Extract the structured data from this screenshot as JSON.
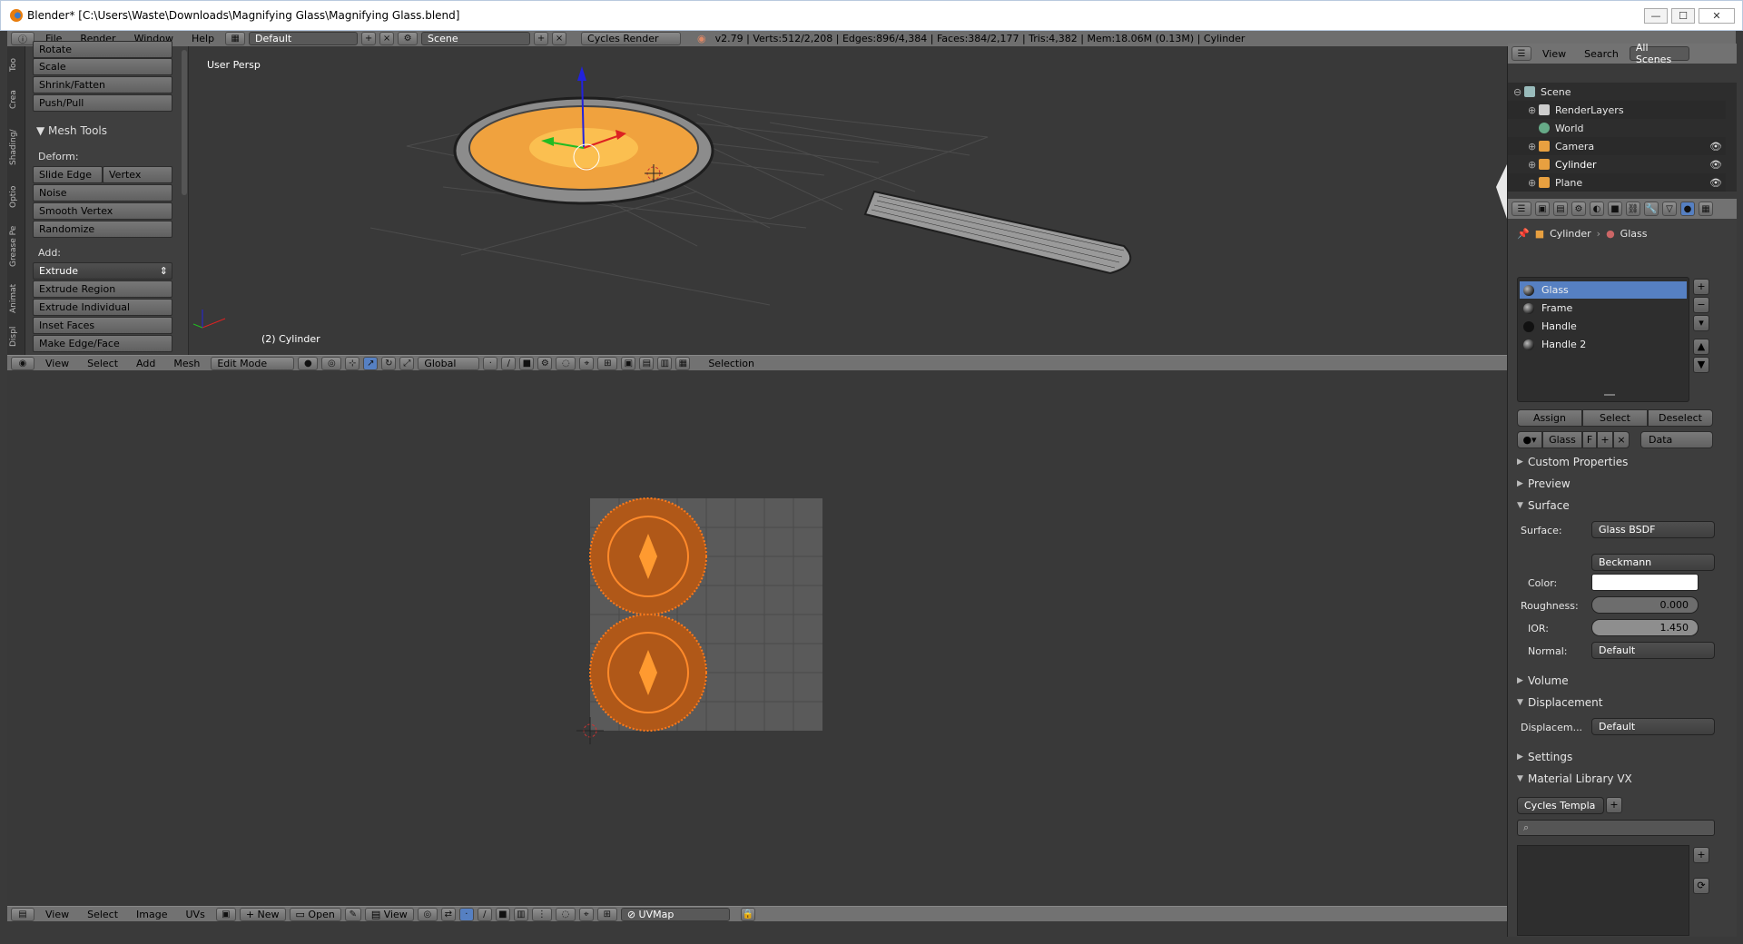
{
  "window": {
    "title": "Blender* [C:\\Users\\Waste\\Downloads\\Magnifying Glass\\Magnifying Glass.blend]",
    "minimize": "—",
    "maximize": "☐",
    "close": "✕"
  },
  "topbar": {
    "menus": [
      "File",
      "Render",
      "Window",
      "Help"
    ],
    "layout": "Default",
    "scene": "Scene",
    "engine": "Cycles Render",
    "stats": "v2.79 | Verts:512/2,208 | Edges:896/4,384 | Faces:384/2,177 | Tris:4,382 | Mem:18.06M (0.13M) | Cylinder"
  },
  "tools": {
    "tabs": [
      "Too",
      "Crea",
      "Shading/",
      "Optio",
      "Grease Pe",
      "Animat",
      "Displ"
    ],
    "transform_buttons": [
      "Rotate",
      "Scale",
      "Shrink/Fatten",
      "Push/Pull"
    ],
    "mesh_tools_title": "Mesh Tools",
    "deform_label": "Deform:",
    "slide_edge": "Slide Edge",
    "vertex": "Vertex",
    "deform_buttons": [
      "Noise",
      "Smooth Vertex",
      "Randomize"
    ],
    "add_label": "Add:",
    "extrude": "Extrude",
    "add_buttons": [
      "Extrude Region",
      "Extrude Individual",
      "Inset Faces",
      "Make Edge/Face"
    ]
  },
  "viewport3d": {
    "view_label": "User Persp",
    "object_label": "(2) Cylinder"
  },
  "view3d_header": {
    "menus": [
      "View",
      "Select",
      "Add",
      "Mesh"
    ],
    "mode": "Edit Mode",
    "orientation": "Global",
    "selection": "Selection"
  },
  "uv_header": {
    "menus": [
      "View",
      "Select",
      "Image",
      "UVs"
    ],
    "new": "New",
    "open": "Open",
    "view": "View",
    "uvmap": "UVMap"
  },
  "outliner": {
    "view": "View",
    "search": "Search",
    "scope": "All Scenes",
    "items": [
      "Scene",
      "RenderLayers",
      "World",
      "Camera",
      "Cylinder",
      "Plane"
    ]
  },
  "properties": {
    "breadcrumb_object": "Cylinder",
    "breadcrumb_material": "Glass",
    "materials": [
      "Glass",
      "Frame",
      "Handle",
      "Handle 2"
    ],
    "assign": "Assign",
    "select": "Select",
    "deselect": "Deselect",
    "mat_name": "Glass",
    "fake": "F",
    "link": "Data",
    "panels": {
      "custom": "Custom Properties",
      "preview": "Preview",
      "surface": "Surface",
      "volume": "Volume",
      "displacement": "Displacement",
      "settings": "Settings",
      "matlib": "Material Library VX"
    },
    "surface_label": "Surface:",
    "surface_value": "Glass BSDF",
    "distribution": "Beckmann",
    "color_label": "Color:",
    "color_value": "#ffffff",
    "roughness_label": "Roughness:",
    "roughness_value": "0.000",
    "ior_label": "IOR:",
    "ior_value": "1.450",
    "normal_label": "Normal:",
    "normal_value": "Default",
    "displacement_label": "Displacem...",
    "displacement_value": "Default",
    "template": "Cycles Templa"
  }
}
